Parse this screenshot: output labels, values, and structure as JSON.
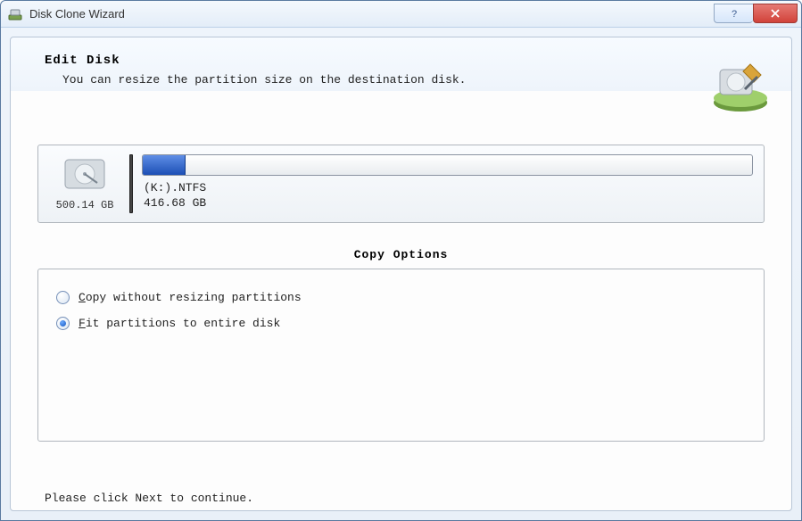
{
  "window": {
    "title": "Disk Clone Wizard"
  },
  "header": {
    "heading": "Edit Disk",
    "subtext": "You can resize the partition size on the destination disk."
  },
  "disk": {
    "total_size": "500.14 GB",
    "partition_name": "(K:).NTFS",
    "partition_size": "416.68 GB",
    "fill_percent": 7
  },
  "copy_options": {
    "title": "Copy Options",
    "selected_index": 1,
    "items": [
      {
        "label_pre": "",
        "accel": "C",
        "label_post": "opy without resizing partitions"
      },
      {
        "label_pre": "",
        "accel": "F",
        "label_post": "it partitions to entire disk"
      }
    ]
  },
  "footer": {
    "hint": "Please click Next to continue."
  }
}
